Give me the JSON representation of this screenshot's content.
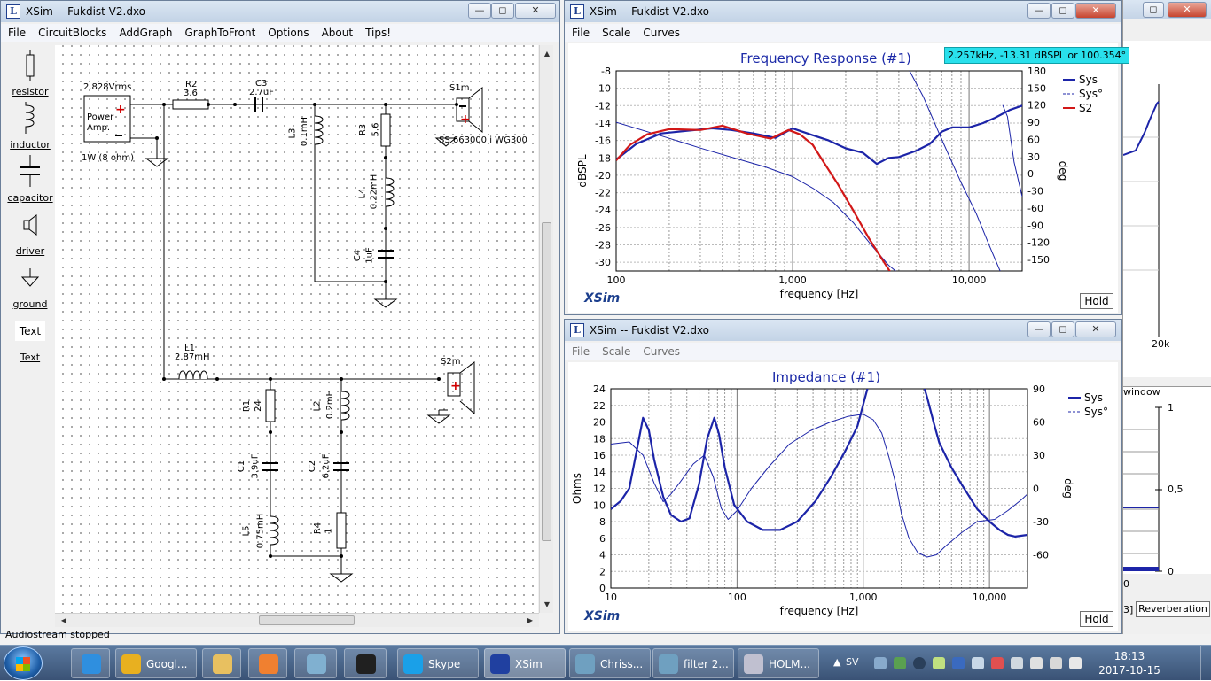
{
  "status_bar": {
    "text": "Audiostream stopped"
  },
  "schematic": {
    "title": "XSim -- Fukdist V2.dxo",
    "menu": [
      "File",
      "CircuitBlocks",
      "AddGraph",
      "GraphToFront",
      "Options",
      "About",
      "Tips!"
    ],
    "palette": [
      {
        "label": "resistor",
        "icon": "resistor-icon"
      },
      {
        "label": "inductor",
        "icon": "inductor-icon"
      },
      {
        "label": "capacitor",
        "icon": "capacitor-icon"
      },
      {
        "label": "driver",
        "icon": "driver-icon"
      },
      {
        "label": "ground",
        "icon": "ground-icon"
      },
      {
        "label": "Text",
        "preview": "Text"
      }
    ],
    "components": {
      "source_voltage": "2.828Vrms",
      "source_name": "Power\nAmp.",
      "source_rating": "1W (8 ohm)",
      "R2_name": "R2",
      "R2_val": "3.6",
      "C3_name": "C3",
      "C3_val": "2.7uF",
      "L3_name": "L3",
      "L3_val": "0.1mH",
      "R3_name": "R3",
      "R3_val": "5.6",
      "L4_name": "L4",
      "L4_val": "0.22mH",
      "C4_name": "C4",
      "C4_val": "1uF",
      "S1m_name": "S1m",
      "S1m_val": "SS 663000 i WG300",
      "L1_name": "L1",
      "L1_val": "2.87mH",
      "S2m_name": "S2m",
      "R1_name": "R1",
      "R1_val": "24",
      "L2_name": "L2",
      "L2_val": "0.2mH",
      "C1_name": "C1",
      "C1_val": "3.9uF",
      "C2_name": "C2",
      "C2_val": "6.2uF",
      "L5_name": "L5",
      "L5_val": "0.75mH",
      "R4_name": "R4",
      "R4_val": "1"
    }
  },
  "freq_window": {
    "title": "XSim -- Fukdist V2.dxo",
    "menu": [
      "File",
      "Scale",
      "Curves"
    ],
    "readout": "2.257kHz, -13.31 dBSPL or 100.354°",
    "brand": "XSim",
    "hold_label": "Hold",
    "chart_data": {
      "type": "line",
      "title": "Frequency Response (#1)",
      "xlabel": "frequency [Hz]",
      "ylabel": "dBSPL",
      "y2label": "deg",
      "xscale": "log",
      "xlim": [
        100,
        20000
      ],
      "ylim": [
        -31,
        -8
      ],
      "y2lim": [
        -170,
        180
      ],
      "x_tick_labels": [
        "100",
        "1,000",
        "10,000"
      ],
      "y_ticks": [
        -8,
        -10,
        -12,
        -14,
        -16,
        -18,
        -20,
        -22,
        -24,
        -26,
        -28,
        -30
      ],
      "y2_ticks": [
        180,
        150,
        120,
        90,
        60,
        30,
        0,
        -30,
        -60,
        -90,
        -120,
        -150
      ],
      "grid": true,
      "legend": "top-right",
      "series": [
        {
          "name": "Sys",
          "axis": "y",
          "color": "#1c24a8",
          "style": "solid-thick",
          "x": [
            100,
            130,
            180,
            250,
            350,
            450,
            600,
            800,
            1000,
            1300,
            1600,
            2000,
            2500,
            3000,
            3500,
            4000,
            5000,
            6000,
            7000,
            8000,
            10000,
            12000,
            14000,
            17000,
            20000
          ],
          "y": [
            -18.2,
            -16.4,
            -15.2,
            -14.9,
            -14.6,
            -14.8,
            -15.2,
            -15.7,
            -14.6,
            -15.4,
            -16.0,
            -16.9,
            -17.4,
            -18.7,
            -18.0,
            -17.9,
            -17.2,
            -16.4,
            -15.0,
            -14.5,
            -14.5,
            -14.0,
            -13.4,
            -12.5,
            -12.0
          ]
        },
        {
          "name": "Sys°",
          "axis": "y2",
          "color": "#1c24a8",
          "style": "solid-thin",
          "x": [
            100,
            200,
            300,
            500,
            700,
            1000,
            1300,
            1700,
            2200,
            2800,
            3500,
            4200,
            4600,
            4601,
            5500,
            7000,
            9000,
            11000,
            13000,
            15000,
            15500,
            15501,
            16500,
            18000,
            20000
          ],
          "y": [
            90,
            62,
            45,
            25,
            12,
            -5,
            -25,
            -50,
            -85,
            -125,
            -160,
            -180,
            -200,
            180,
            135,
            60,
            -15,
            -70,
            -125,
            -170,
            -200,
            120,
            100,
            20,
            -40
          ]
        },
        {
          "name": "S2",
          "axis": "y",
          "color": "#d21818",
          "style": "solid-thick",
          "x": [
            100,
            120,
            150,
            200,
            300,
            400,
            550,
            750,
            950,
            1100,
            1300,
            1500,
            1800,
            2200,
            2700,
            3300,
            3600
          ],
          "y": [
            -18.3,
            -16.5,
            -15.3,
            -14.7,
            -14.8,
            -14.3,
            -15.2,
            -15.8,
            -14.8,
            -15.3,
            -16.5,
            -18.5,
            -21.0,
            -24.0,
            -27.2,
            -30.0,
            -31.2
          ]
        }
      ]
    }
  },
  "imp_window": {
    "title": "XSim -- Fukdist V2.dxo",
    "menu": [
      "File",
      "Scale",
      "Curves"
    ],
    "brand": "XSim",
    "hold_label": "Hold",
    "chart_data": {
      "type": "line",
      "title": "Impedance (#1)",
      "xlabel": "frequency [Hz]",
      "ylabel": "Ohms",
      "y2label": "deg",
      "xscale": "log",
      "xlim": [
        10,
        20000
      ],
      "ylim": [
        0,
        24
      ],
      "y2lim": [
        -90,
        90
      ],
      "x_tick_labels": [
        "10",
        "100",
        "1,000",
        "10,000"
      ],
      "y_ticks": [
        24,
        22,
        20,
        18,
        16,
        14,
        12,
        10,
        8,
        6,
        4,
        2,
        0
      ],
      "y2_ticks": [
        90,
        60,
        30,
        0,
        -30,
        -60
      ],
      "grid": true,
      "legend": "top-right",
      "series": [
        {
          "name": "Sys",
          "axis": "y",
          "color": "#1c24a8",
          "style": "solid-thick",
          "x": [
            10,
            12,
            14,
            16,
            18,
            20,
            22,
            26,
            30,
            36,
            42,
            50,
            58,
            66,
            72,
            80,
            95,
            120,
            160,
            220,
            300,
            420,
            560,
            720,
            900,
            1100,
            1300,
            1500,
            2000,
            2400,
            2800,
            3200,
            3600,
            4000,
            5000,
            6000,
            8000,
            10000,
            12000,
            14000,
            16000,
            20000
          ],
          "y": [
            9.5,
            10.5,
            12,
            16.5,
            20.5,
            19,
            15.5,
            11,
            8.8,
            8.0,
            8.4,
            12.5,
            18,
            20.5,
            18.5,
            14.5,
            10,
            8,
            7.0,
            7.0,
            8.0,
            10.5,
            13.5,
            16.5,
            19.5,
            24.5,
            30,
            35,
            36,
            30,
            26,
            23,
            20,
            17.5,
            14.5,
            12.5,
            9.5,
            8.0,
            7.0,
            6.4,
            6.2,
            6.4
          ]
        },
        {
          "name": "Sys°",
          "axis": "y2",
          "color": "#1c24a8",
          "style": "solid-thin",
          "x": [
            10,
            14,
            18,
            22,
            26,
            30,
            35,
            45,
            55,
            65,
            75,
            85,
            100,
            130,
            180,
            260,
            380,
            550,
            750,
            1000,
            1200,
            1400,
            1600,
            1800,
            2000,
            2300,
            2700,
            3200,
            3800,
            4500,
            6000,
            8000,
            11000,
            14000,
            18000,
            20000
          ],
          "y": [
            40,
            42,
            30,
            5,
            -12,
            -5,
            5,
            22,
            30,
            10,
            -18,
            -28,
            -20,
            0,
            20,
            40,
            52,
            60,
            65,
            67,
            62,
            50,
            28,
            5,
            -22,
            -45,
            -58,
            -62,
            -60,
            -52,
            -40,
            -30,
            -28,
            -20,
            -10,
            -5
          ]
        }
      ]
    }
  },
  "right_window": {
    "tick_20k": "20k",
    "window_label": "window",
    "val_1": "1",
    "val_05": "0,5",
    "val_0": "0",
    "partial_0": "0",
    "partial_3": "3]",
    "button": "Reverberation"
  },
  "taskbar": {
    "items": [
      {
        "label": "",
        "icon": "ie-icon",
        "color": "#2f8fdf"
      },
      {
        "label": "Googl...",
        "icon": "chrome-icon",
        "color": "#e8b020"
      },
      {
        "label": "",
        "icon": "explorer-icon",
        "color": "#e8c060"
      },
      {
        "label": "",
        "icon": "media-icon",
        "color": "#f08030"
      },
      {
        "label": "",
        "icon": "app-icon",
        "color": "#80b0d0"
      },
      {
        "label": "",
        "icon": "app2-icon",
        "color": "#202020"
      },
      {
        "label": "Skype",
        "icon": "skype-icon",
        "color": "#1aa0e8"
      },
      {
        "label": "XSim",
        "icon": "xsim-icon",
        "color": "#2040a0"
      },
      {
        "label": "Chriss...",
        "icon": "photo-icon",
        "color": "#6fa0c0"
      },
      {
        "label": "filter 2...",
        "icon": "photo-icon",
        "color": "#6fa0c0"
      },
      {
        "label": "HOLM...",
        "icon": "holm-icon",
        "color": "#c0c0d0"
      }
    ],
    "lang": "SV",
    "time": "18:13",
    "date": "2017-10-15"
  }
}
